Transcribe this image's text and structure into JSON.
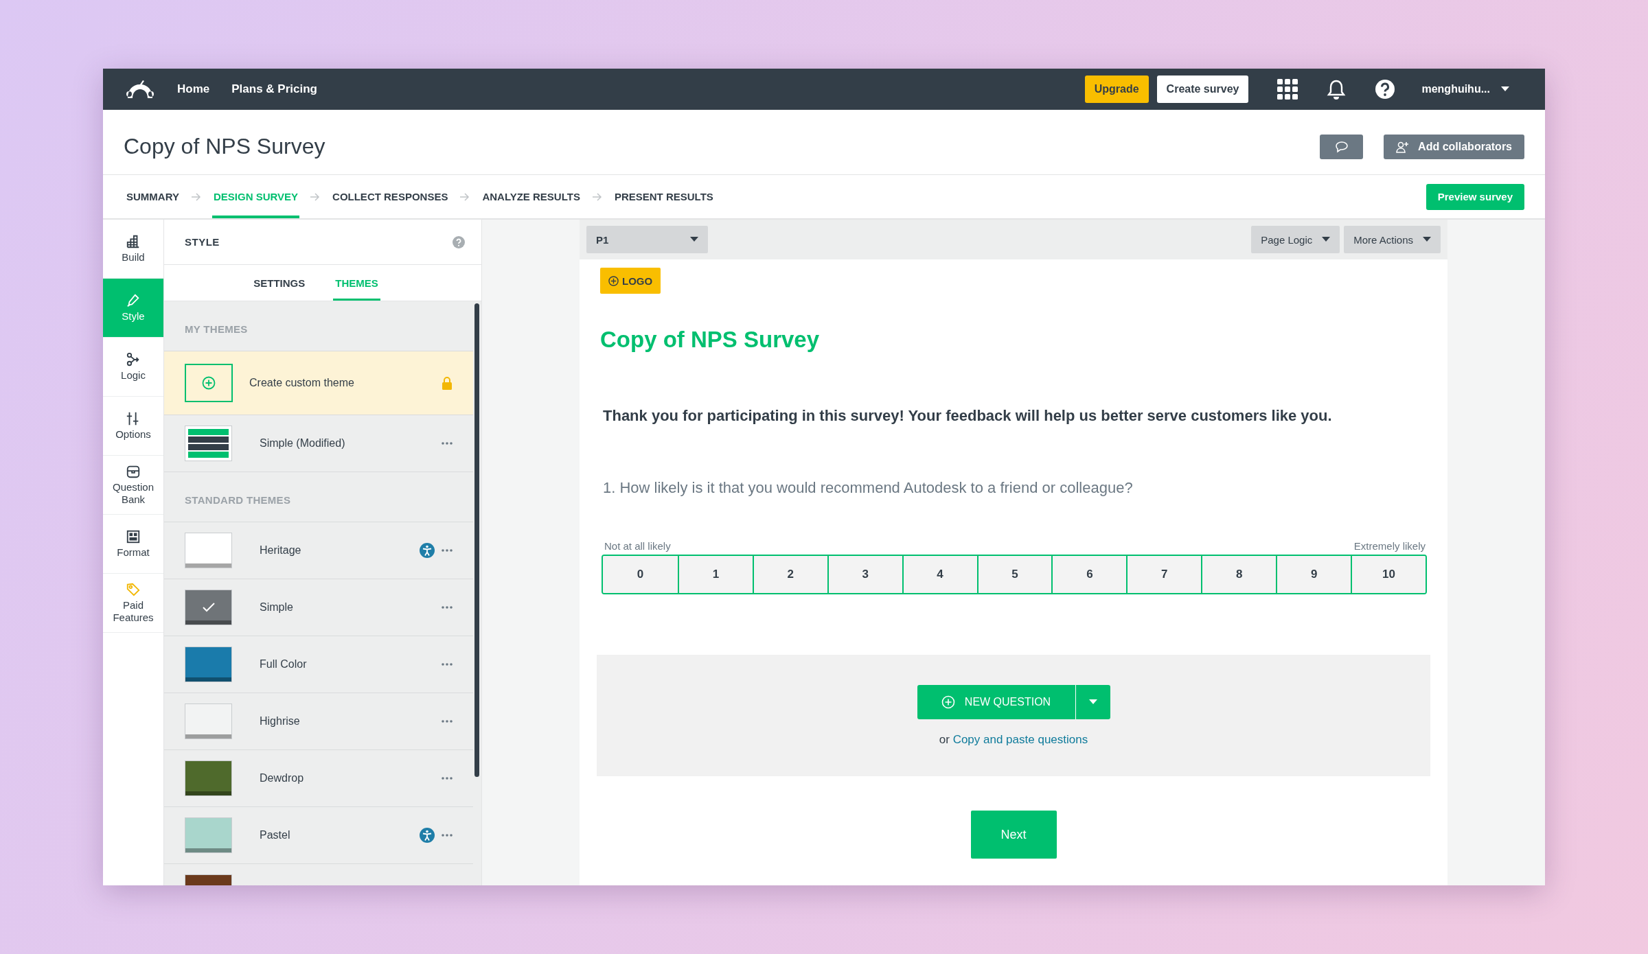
{
  "topbar": {
    "nav_links": [
      {
        "label": "Home"
      },
      {
        "label": "Plans & Pricing"
      }
    ],
    "upgrade_button": "Upgrade",
    "create_button": "Create survey",
    "user": "menghuihu..."
  },
  "header": {
    "title": "Copy of NPS Survey",
    "add_collaborators": "Add collaborators"
  },
  "steps": [
    {
      "label": "SUMMARY",
      "selected": false
    },
    {
      "label": "DESIGN SURVEY",
      "selected": true
    },
    {
      "label": "COLLECT RESPONSES",
      "selected": false
    },
    {
      "label": "ANALYZE RESULTS",
      "selected": false
    },
    {
      "label": "PRESENT RESULTS",
      "selected": false
    }
  ],
  "preview_button": "Preview survey",
  "rail": [
    {
      "kind": "build",
      "label": "Build",
      "selected": false
    },
    {
      "kind": "style",
      "label": "Style",
      "selected": true
    },
    {
      "kind": "logic",
      "label": "Logic",
      "selected": false
    },
    {
      "kind": "options",
      "label": "Options",
      "selected": false
    },
    {
      "kind": "bank",
      "label": "Question Bank",
      "selected": false
    },
    {
      "kind": "format",
      "label": "Format",
      "selected": false
    },
    {
      "kind": "paid",
      "label": "Paid Features",
      "selected": false
    }
  ],
  "style_panel": {
    "title": "STYLE",
    "tabs": [
      {
        "label": "SETTINGS",
        "selected": false
      },
      {
        "label": "THEMES",
        "selected": true
      }
    ],
    "my_themes_heading": "MY THEMES",
    "my_themes": [
      {
        "kind": "create",
        "label": "Create custom theme",
        "locked": true
      },
      {
        "kind": "theme",
        "label": "Simple (Modified)"
      }
    ],
    "standard_heading": "STANDARD THEMES",
    "standard_themes": [
      {
        "label": "Heritage",
        "color": "#ffffff",
        "selected": false,
        "accessible": true
      },
      {
        "label": "Simple",
        "color": "#6f7478",
        "selected": true,
        "accessible": false
      },
      {
        "label": "Full Color",
        "color": "#1a7bab",
        "selected": false,
        "accessible": false
      },
      {
        "label": "Highrise",
        "color": "#f2f3f3",
        "selected": false,
        "accessible": false
      },
      {
        "label": "Dewdrop",
        "color": "#4f6a2c",
        "selected": false,
        "accessible": false
      },
      {
        "label": "Pastel",
        "color": "#a9d6cc",
        "selected": false,
        "accessible": true
      },
      {
        "color": "#6b3a1c",
        "selected": false,
        "accessible": false
      }
    ]
  },
  "page_bar": {
    "page": "P1",
    "page_logic": "Page Logic",
    "more_actions": "More Actions"
  },
  "survey": {
    "logo_button": "LOGO",
    "title": "Copy of NPS Survey",
    "intro": "Thank you for participating in this survey! Your feedback will help us better serve customers like you.",
    "question": "1. How likely is it that you would recommend Autodesk to a friend or colleague?",
    "low_label": "Not at all likely",
    "high_label": "Extremely likely",
    "scale": [
      "0",
      "1",
      "2",
      "3",
      "4",
      "5",
      "6",
      "7",
      "8",
      "9",
      "10"
    ],
    "new_question": "NEW QUESTION",
    "or_text": "or",
    "copy_link": "Copy and paste questions",
    "next": "Next"
  }
}
